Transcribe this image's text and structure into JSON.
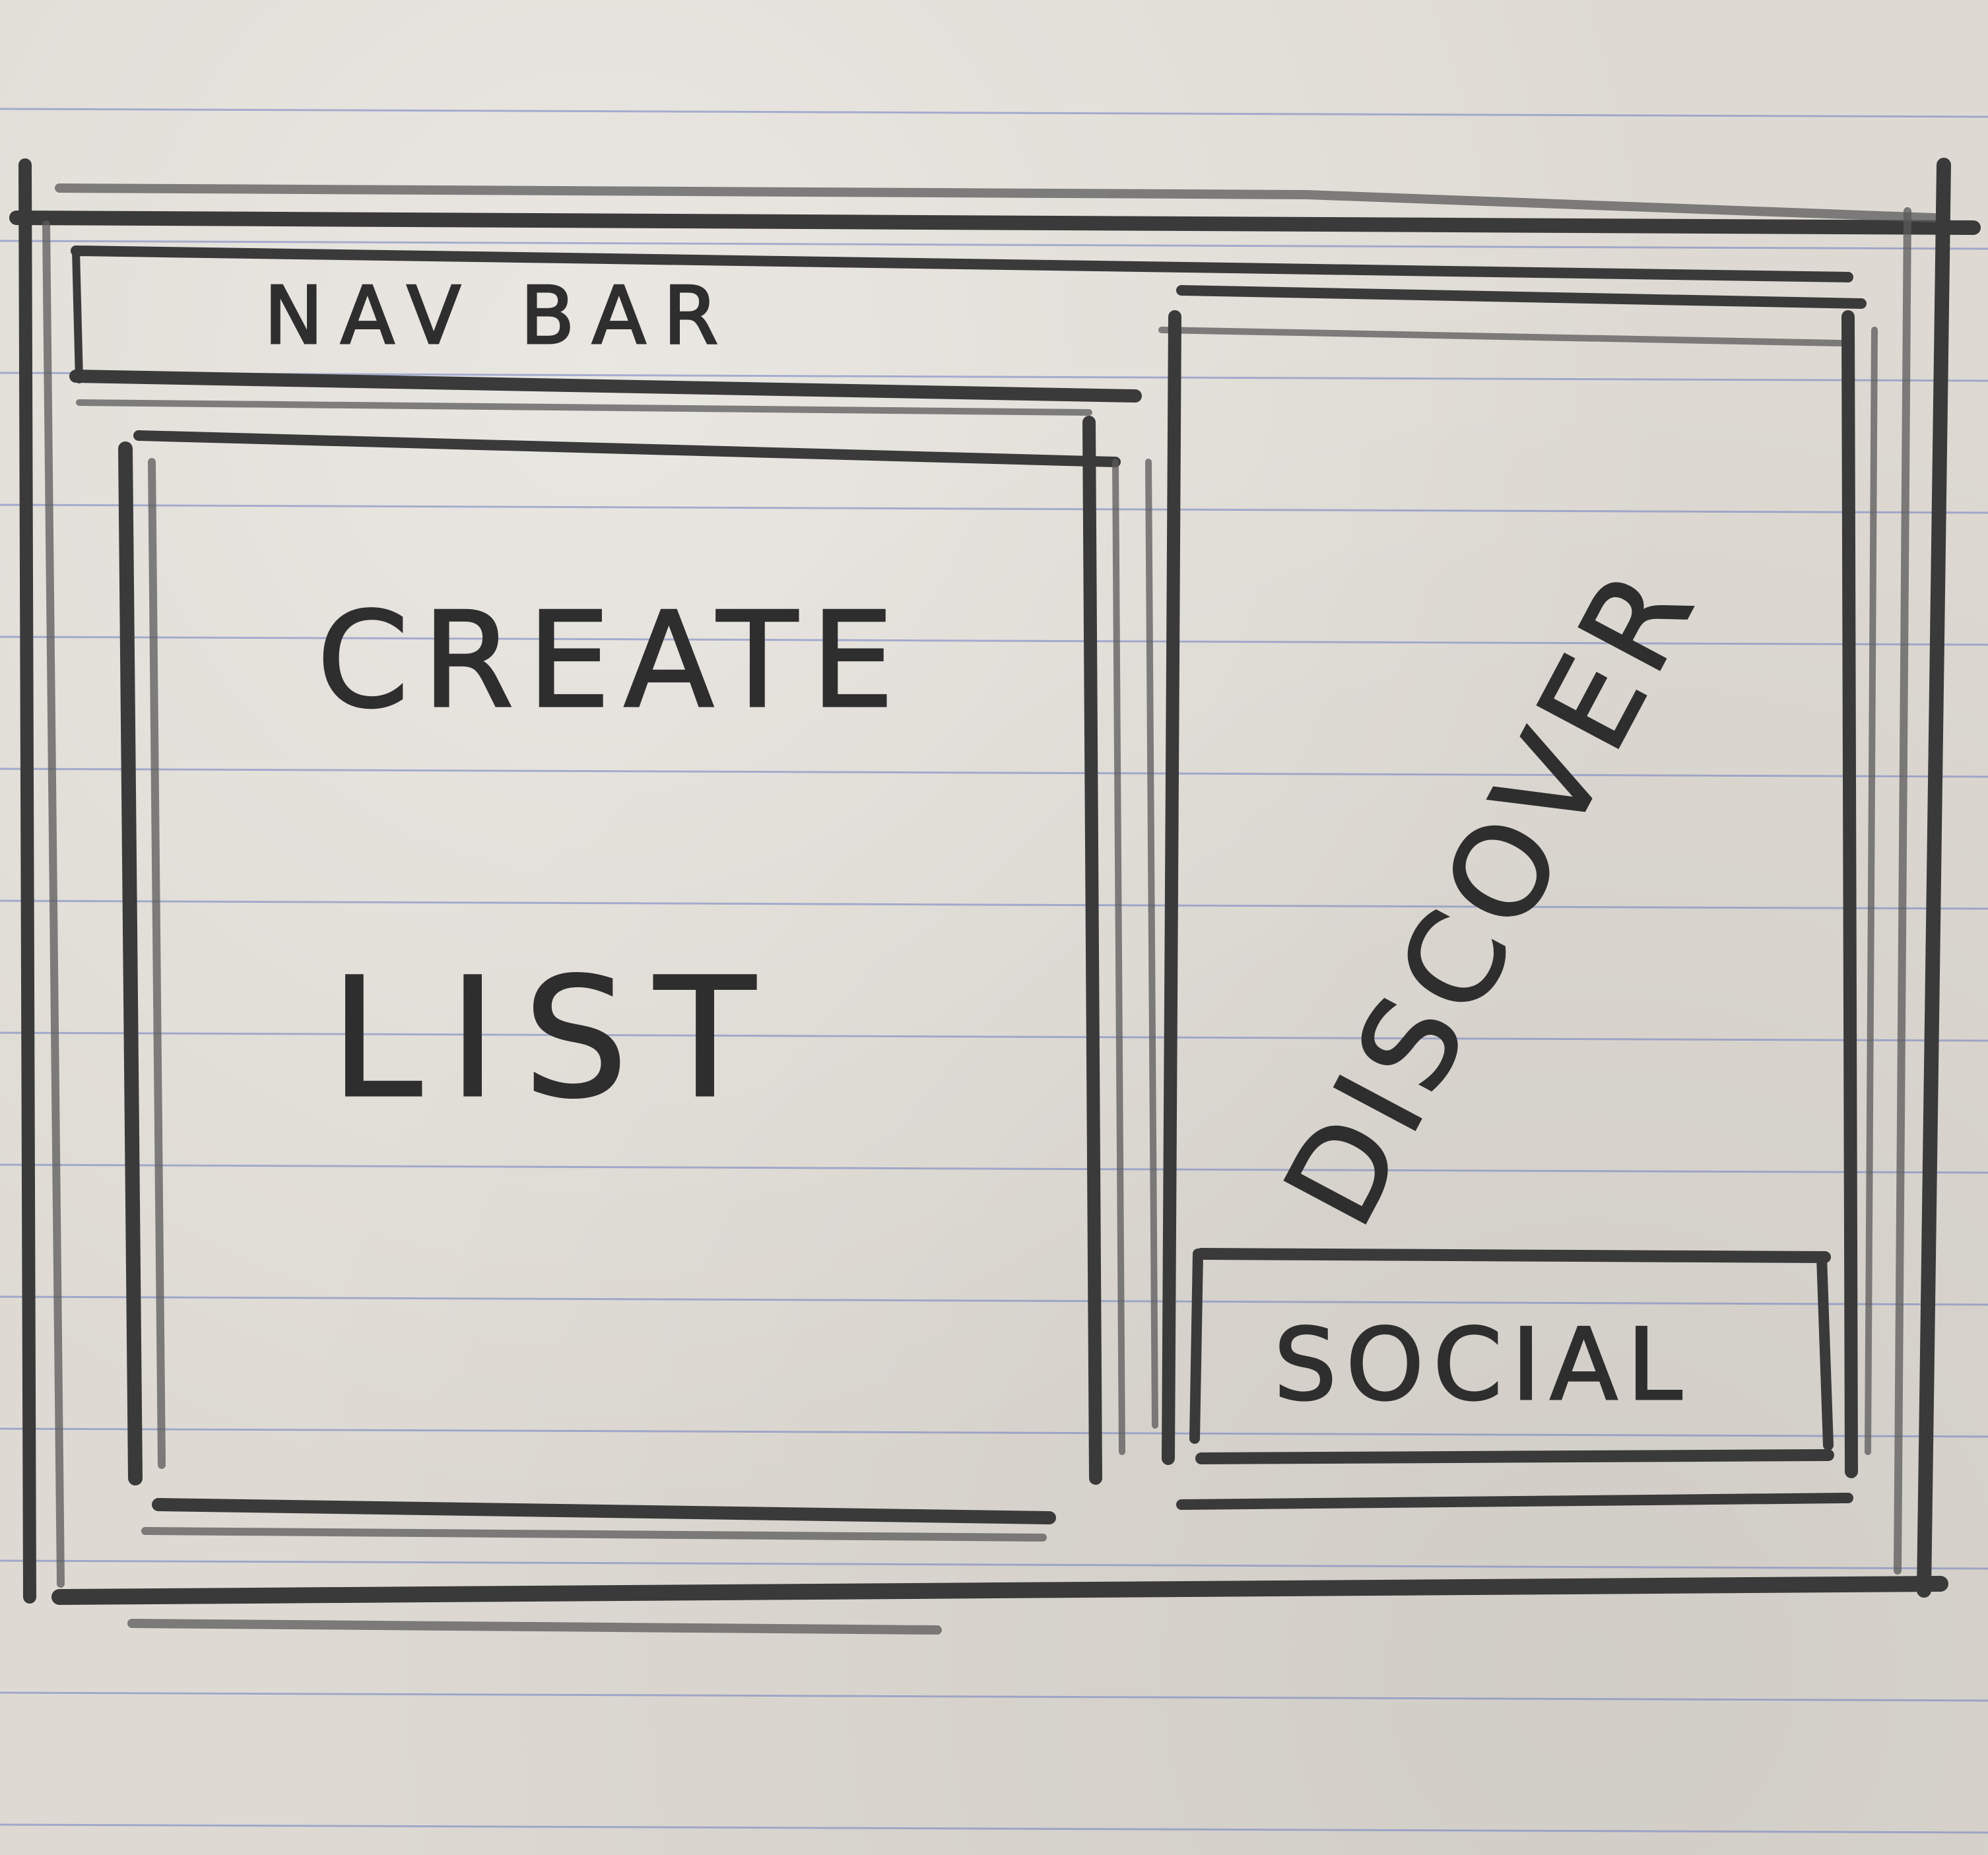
{
  "sketch": {
    "nav_bar_label": "NAV BAR",
    "create_label": "CREATE",
    "list_label": "LIST",
    "discover_label": "DISCOVER",
    "social_label": "SOCIAL"
  },
  "colors": {
    "paper": "#dedad3",
    "ruled_line": "#6f7fc0",
    "pencil": "#3a3a3a"
  }
}
